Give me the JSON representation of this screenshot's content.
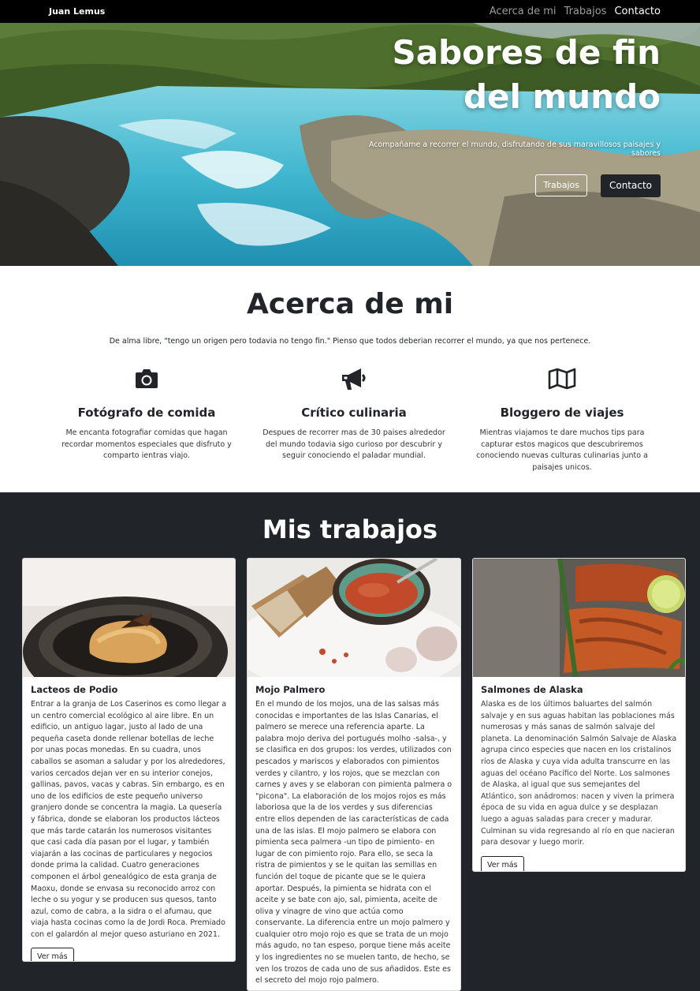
{
  "navbar": {
    "brand": "Juan Lemus",
    "links": [
      "Acerca de mi",
      "Trabajos",
      "Contacto"
    ]
  },
  "hero": {
    "title": "Sabores de fin del mundo",
    "subtitle": "Acompañame a recorrer el mundo, disfrutando de sus maravillosos paisajes y sabores",
    "btn_works": "Trabajos",
    "btn_contact": "Contacto"
  },
  "about": {
    "heading": "Acerca de mi",
    "intro": "De alma libre, \"tengo un origen pero todavia no tengo fin.\" Pienso que todos deberian recorrer el mundo, ya que nos pertenece.",
    "features": [
      {
        "icon": "camera-icon",
        "title": "Fotógrafo de comida",
        "text": "Me encanta fotografiar comidas que hagan recordar momentos especiales que disfruto y comparto ientras viajo."
      },
      {
        "icon": "megaphone-icon",
        "title": "Crítico culinaria",
        "text": "Despues de recorrer mas de 30 paises alrededor del mundo todavia sigo curioso por descubrir y seguir conociendo el paladar mundial."
      },
      {
        "icon": "map-icon",
        "title": "Bloggero de viajes",
        "text": "Mientras viajamos te dare muchos tips para capturar estos magicos que descubriremos conociendo nuevas culturas culinarias junto a paisajes unicos."
      }
    ]
  },
  "works": {
    "heading": "Mis trabajos",
    "more_label": "Ver más",
    "cards": [
      {
        "title": "Lacteos de Podio",
        "text": "Entrar a la granja de Los Caserinos es como llegar a un centro comercial ecológico al aire libre. En un edificio, un antiguo lagar, justo al lado de una pequeña caseta donde rellenar botellas de leche por unas pocas monedas. En su cuadra, unos caballos se asoman a saludar y por los alrededores, varios cercados dejan ver en su interior conejos, gallinas, pavos, vacas y cabras. Sin embargo, es en uno de los edificios de este pequeño universo granjero donde se concentra la magia. La quesería y fábrica, donde se elaboran los productos lácteos que más tarde catarán los numerosos visitantes que casi cada día pasan por el lugar, y también viajarán a las cocinas de particulares y negocios donde prima la calidad. Cuatro generaciones componen el árbol genealógico de esta granja de Maoxu, donde se envasa su reconocido arroz con leche o su yogur y se producen sus quesos, tanto azul, como de cabra, a la sidra o el afumau, que viaja hasta cocinas como la de Jordi Roca. Premiado con el galardón al mejor queso asturiano en 2021."
      },
      {
        "title": "Mojo Palmero",
        "text": "En el mundo de los mojos, una de las salsas más conocidas e importantes de las Islas Canarias, el palmero se merece una referencia aparte. La palabra mojo deriva del portugués molho -salsa-, y se clasifica en dos grupos: los verdes, utilizados con pescados y mariscos y elaborados con pimientos verdes y cilantro, y los rojos, que se mezclan con carnes y aves y se elaboran con pimienta palmera o \"picona\". La elaboración de los mojos rojos es más laboriosa que la de los verdes y sus diferencias entre ellos dependen de las características de cada una de las islas. El mojo palmero se elabora con pimienta seca palmera -un tipo de pimiento- en lugar de con pimiento rojo. Para ello, se seca la ristra de pimientos y se le quitan las semillas en función del toque de picante que se le quiera aportar. Después, la pimienta se hidrata con el aceite y se bate con ajo, sal, pimienta, aceite de oliva y vinagre de vino que actúa como conservante. La diferencia entre un mojo palmero y cualquier otro mojo rojo es que se trata de un mojo más agudo, no tan espeso, porque tiene más aceite y los ingredientes no se muelen tanto, de hecho, se ven los trozos de cada uno de sus añadidos. Este es el secreto del mojo rojo palmero."
      },
      {
        "title": "Salmones de Alaska",
        "text": "Alaska es de los últimos baluartes del salmón salvaje y en sus aguas habitan las poblaciones más numerosas y más sanas de salmón salvaje del planeta. La denominación Salmón Salvaje de Alaska agrupa cinco especies que nacen en los cristalinos ríos de Alaska y cuya vida adulta transcurre en las aguas del océano Pacífico del Norte. Los salmones de Alaska, al igual que sus semejantes del Atlántico, son anádromos: nacen y viven la primera época de su vida en agua dulce y se desplazan luego a aguas saladas para crecer y madurar. Culminan su vida regresando al río en que nacieran para desovar y luego morir."
      }
    ]
  }
}
